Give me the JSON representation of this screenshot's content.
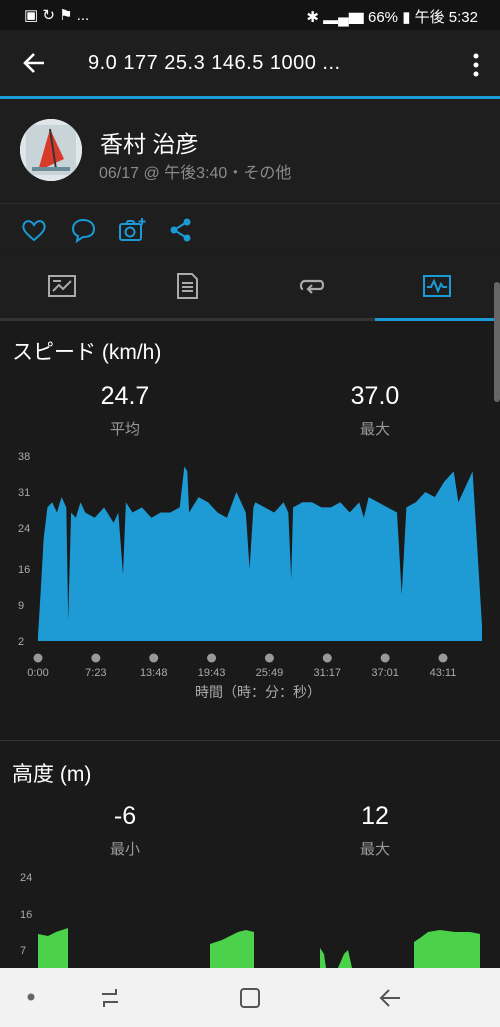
{
  "status_bar": {
    "left_icons": "▣ ↻ ⚑ ...",
    "battery": "66%",
    "time": "午後 5:32"
  },
  "app_bar": {
    "title": "9.0   177   25.3   146.5   1000   ..."
  },
  "activity": {
    "name": "香村 治彦",
    "subtitle": "06/17 @ 午後3:40・その他"
  },
  "speed": {
    "title": "スピード (km/h)",
    "avg_value": "24.7",
    "avg_label": "平均",
    "max_value": "37.0",
    "max_label": "最大",
    "x_axis_label": "時間（時：分：秒）"
  },
  "altitude": {
    "title": "高度 (m)",
    "min_value": "-6",
    "min_label": "最小",
    "max_value": "12",
    "max_label": "最大"
  },
  "colors": {
    "accent": "#1a9ad6",
    "speed_fill": "#1e9bd5",
    "altitude_fill": "#4cd24a"
  },
  "chart_data": [
    {
      "type": "area",
      "title": "スピード (km/h)",
      "xlabel": "時間（時：分：秒）",
      "ylabel": "",
      "x_ticks": [
        "0:00",
        "7:23",
        "13:48",
        "19:43",
        "25:49",
        "31:17",
        "37:01",
        "43:11"
      ],
      "y_ticks": [
        2,
        9,
        16,
        24,
        31,
        38
      ],
      "ylim": [
        2,
        38
      ],
      "xlim": [
        0,
        47
      ],
      "x": [
        0,
        0.3,
        0.6,
        1,
        1.5,
        2,
        2.5,
        3,
        3.2,
        3.5,
        4,
        4.5,
        5,
        6,
        7,
        8,
        8.5,
        9,
        9.3,
        10,
        11,
        12,
        13,
        14,
        15,
        15.5,
        15.8,
        16,
        17,
        18,
        19,
        20,
        21,
        22,
        22.4,
        22.8,
        23,
        24,
        25,
        26,
        26.5,
        26.8,
        27,
        28,
        29,
        30,
        31,
        32,
        33,
        34,
        34.5,
        35,
        36,
        37,
        38,
        38.5,
        39,
        40,
        41,
        42,
        43,
        44,
        44.5,
        45,
        46,
        46.5,
        47
      ],
      "values": [
        3,
        12,
        22,
        28,
        29,
        27,
        30,
        28,
        6,
        27,
        26,
        29,
        27,
        26,
        28,
        25,
        27,
        15,
        29,
        27,
        28,
        26,
        27,
        27,
        28,
        36,
        35,
        27,
        30,
        29,
        27,
        26,
        31,
        27,
        16,
        28,
        29,
        28,
        27,
        29,
        27,
        14,
        28,
        29,
        29,
        28,
        28,
        29,
        27,
        29,
        26,
        30,
        29,
        28,
        27,
        11,
        28,
        29,
        31,
        30,
        33,
        35,
        29,
        31,
        35,
        20,
        5
      ]
    },
    {
      "type": "area",
      "title": "高度 (m)",
      "y_ticks": [
        7,
        16,
        24
      ],
      "note": "partially visible; clipped by navigation bar"
    }
  ],
  "nav_bar": {
    "recent": "recent-apps",
    "home": "home",
    "back": "back"
  }
}
